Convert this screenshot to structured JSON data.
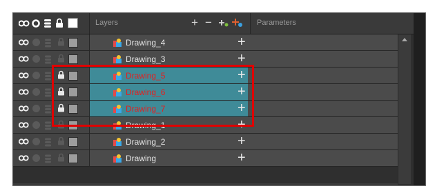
{
  "header": {
    "layers_label": "Layers",
    "params_label": "Parameters",
    "add_layer_label": "+",
    "remove_layer_label": "−"
  },
  "layers": [
    {
      "name": "Drawing_4",
      "selected": false,
      "locked": false
    },
    {
      "name": "Drawing_3",
      "selected": false,
      "locked": false
    },
    {
      "name": "Drawing_5",
      "selected": true,
      "locked": true
    },
    {
      "name": "Drawing_6",
      "selected": true,
      "locked": true
    },
    {
      "name": "Drawing_7",
      "selected": true,
      "locked": true
    },
    {
      "name": "Drawing_1",
      "selected": false,
      "locked": false
    },
    {
      "name": "Drawing_2",
      "selected": false,
      "locked": false
    },
    {
      "name": "Drawing",
      "selected": false,
      "locked": false
    }
  ],
  "colors": {
    "selected_row": "#3f8b98",
    "selected_text": "#e32020",
    "highlight_border": "#e00000"
  },
  "icons": {
    "visibility": "eyes-icon",
    "solo": "solo-circle-icon",
    "stack": "layer-stack-icon",
    "lock": "lock-icon",
    "color_swatch": "color-swatch-icon",
    "drawing": "drawing-layer-icon",
    "add_keyframe": "plus-icon"
  }
}
